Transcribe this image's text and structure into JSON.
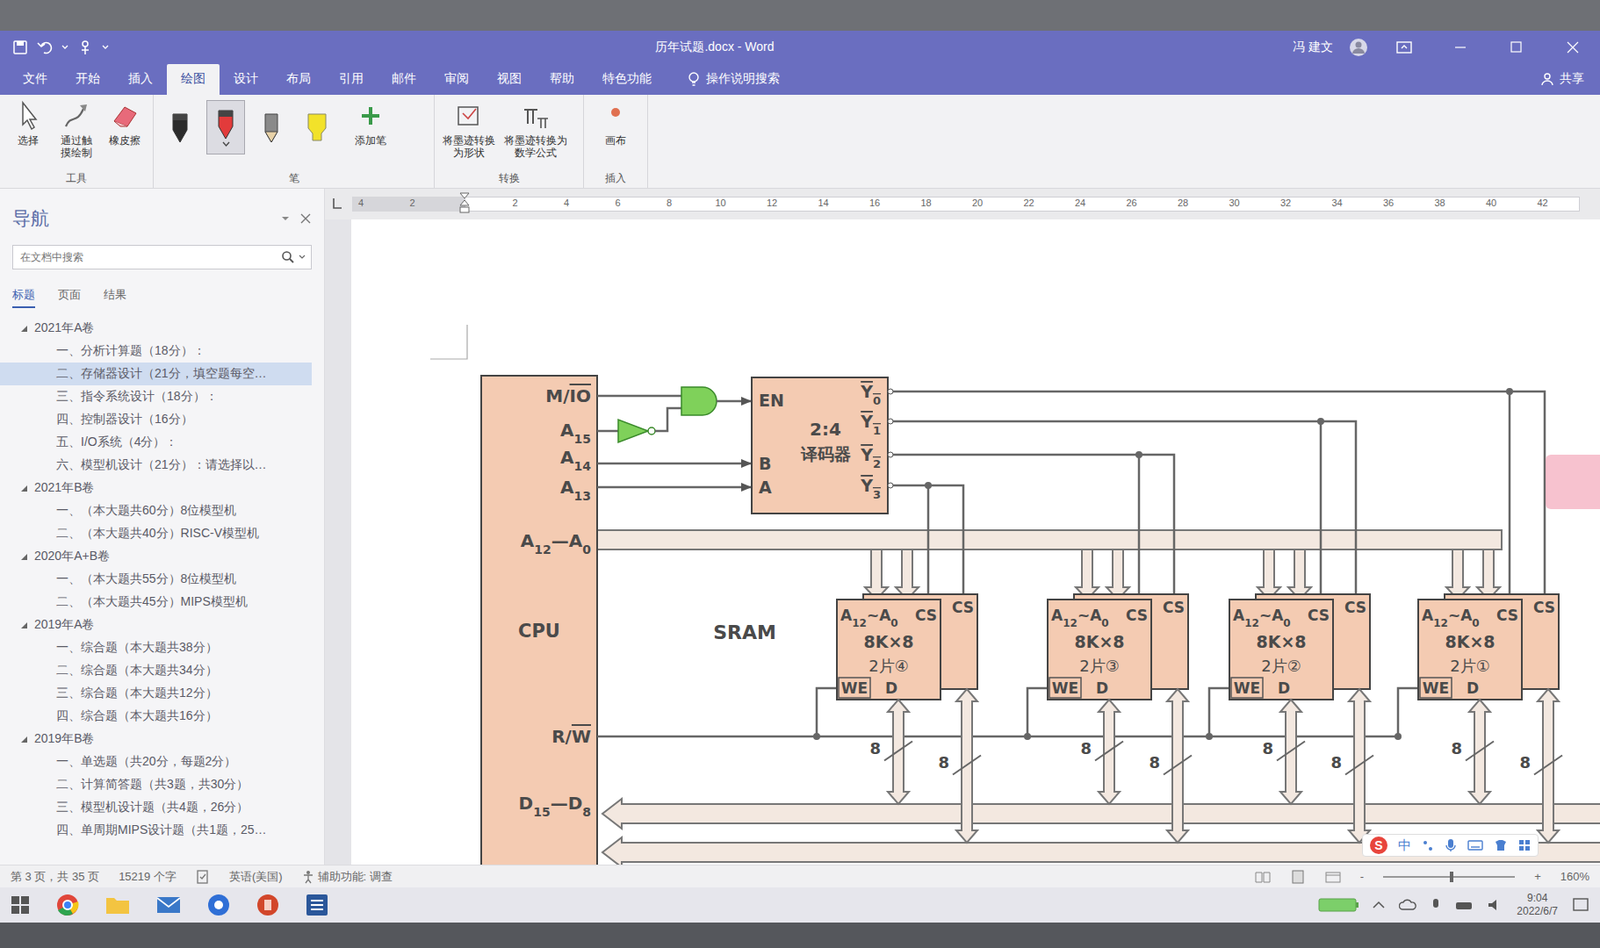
{
  "window": {
    "title": "历年试题.docx - Word",
    "user": "冯 建文"
  },
  "ribbon_tabs": [
    {
      "label": "文件",
      "selected": false
    },
    {
      "label": "开始",
      "selected": false
    },
    {
      "label": "插入",
      "selected": false
    },
    {
      "label": "绘图",
      "selected": true
    },
    {
      "label": "设计",
      "selected": false
    },
    {
      "label": "布局",
      "selected": false
    },
    {
      "label": "引用",
      "selected": false
    },
    {
      "label": "邮件",
      "selected": false
    },
    {
      "label": "审阅",
      "selected": false
    },
    {
      "label": "视图",
      "selected": false
    },
    {
      "label": "帮助",
      "selected": false
    },
    {
      "label": "特色功能",
      "selected": false
    }
  ],
  "tell_me": "操作说明搜索",
  "share": "共享",
  "ribbon": {
    "groups": [
      {
        "label": "工具",
        "items": [
          {
            "kind": "button",
            "label": "选择"
          },
          {
            "kind": "button",
            "label": "通过触摸绘制"
          },
          {
            "kind": "button",
            "label": "橡皮擦"
          }
        ]
      },
      {
        "label": "笔",
        "items": [
          {
            "kind": "pen",
            "color": "#2b2b2b",
            "selected": false
          },
          {
            "kind": "pen",
            "color": "#e23b3b",
            "selected": true
          },
          {
            "kind": "pencil",
            "color": "#8a8a8a",
            "selected": false
          },
          {
            "kind": "highlighter",
            "color": "#f2e22a",
            "selected": false
          },
          {
            "kind": "button",
            "label": "添加笔"
          }
        ]
      },
      {
        "label": "转换",
        "items": [
          {
            "kind": "button",
            "label": "将墨迹转换为形状"
          },
          {
            "kind": "button",
            "label": "将墨迹转换为数学公式"
          }
        ]
      },
      {
        "label": "插入",
        "items": [
          {
            "kind": "button",
            "label": "画布"
          }
        ]
      }
    ]
  },
  "ruler": {
    "left": [
      "4",
      "2"
    ],
    "right": [
      "2",
      "4",
      "6",
      "8",
      "10",
      "12",
      "14",
      "16",
      "18",
      "20",
      "22",
      "24",
      "26",
      "28",
      "30",
      "32",
      "34",
      "36",
      "38",
      "40",
      "42"
    ]
  },
  "nav": {
    "title": "导航",
    "search_placeholder": "在文档中搜索",
    "tabs": [
      {
        "label": "标题",
        "selected": true
      },
      {
        "label": "页面",
        "selected": false
      },
      {
        "label": "结果",
        "selected": false
      }
    ],
    "items": [
      {
        "level": 1,
        "text": "2021年A卷",
        "expanded": true,
        "selected": false
      },
      {
        "level": 2,
        "text": "一、分析计算题（18分）：",
        "selected": false
      },
      {
        "level": 2,
        "text": "二、存储器设计（21分，填空题每空…",
        "selected": true
      },
      {
        "level": 2,
        "text": "三、指令系统设计（18分）：",
        "selected": false
      },
      {
        "level": 2,
        "text": "四、控制器设计（16分）",
        "selected": false
      },
      {
        "level": 2,
        "text": "五、I/O系统（4分）：",
        "selected": false
      },
      {
        "level": 2,
        "text": "六、模型机设计（21分）：请选择以…",
        "selected": false
      },
      {
        "level": 1,
        "text": "2021年B卷",
        "expanded": true,
        "selected": false
      },
      {
        "level": 2,
        "text": "一、（本大题共60分）8位模型机",
        "selected": false
      },
      {
        "level": 2,
        "text": "二、（本大题共40分）RISC-V模型机",
        "selected": false
      },
      {
        "level": 1,
        "text": "2020年A+B卷",
        "expanded": true,
        "selected": false
      },
      {
        "level": 2,
        "text": "一、（本大题共55分）8位模型机",
        "selected": false
      },
      {
        "level": 2,
        "text": "二、（本大题共45分）MIPS模型机",
        "selected": false
      },
      {
        "level": 1,
        "text": "2019年A卷",
        "expanded": true,
        "selected": false
      },
      {
        "level": 2,
        "text": "一、综合题（本大题共38分）",
        "selected": false
      },
      {
        "level": 2,
        "text": "二、综合题（本大题共34分）",
        "selected": false
      },
      {
        "level": 2,
        "text": "三、综合题（本大题共12分）",
        "selected": false
      },
      {
        "level": 2,
        "text": "四、综合题（本大题共16分）",
        "selected": false
      },
      {
        "level": 1,
        "text": "2019年B卷",
        "expanded": true,
        "selected": false
      },
      {
        "level": 2,
        "text": "一、单选题（共20分，每题2分）",
        "selected": false
      },
      {
        "level": 2,
        "text": "二、计算简答题（共3题，共30分）",
        "selected": false
      },
      {
        "level": 2,
        "text": "三、模型机设计题（共4题，26分）",
        "selected": false
      },
      {
        "level": 2,
        "text": "四、单周期MIPS设计题（共1题，25…",
        "selected": false
      }
    ]
  },
  "diagram": {
    "cpu": {
      "label": "CPU",
      "pins": [
        {
          "parts": [
            {
              "t": "M/",
              "kind": "normal"
            },
            {
              "t": "IO",
              "kind": "over"
            }
          ]
        },
        {
          "parts": [
            {
              "t": "A",
              "kind": "normal"
            },
            {
              "t": "15",
              "kind": "sub"
            }
          ]
        },
        {
          "parts": [
            {
              "t": "A",
              "kind": "normal"
            },
            {
              "t": "14",
              "kind": "sub"
            }
          ]
        },
        {
          "parts": [
            {
              "t": "A",
              "kind": "normal"
            },
            {
              "t": "13",
              "kind": "sub"
            }
          ]
        },
        {
          "parts": [
            {
              "t": "A",
              "kind": "normal"
            },
            {
              "t": "12",
              "kind": "sub"
            },
            {
              "t": "—",
              "kind": "normal"
            },
            {
              "t": "A",
              "kind": "normal"
            },
            {
              "t": "0",
              "kind": "sub"
            }
          ]
        },
        {
          "parts": [
            {
              "t": "R/",
              "kind": "normal"
            },
            {
              "t": "W",
              "kind": "over"
            }
          ]
        },
        {
          "parts": [
            {
              "t": "D",
              "kind": "normal"
            },
            {
              "t": "15",
              "kind": "sub"
            },
            {
              "t": "—",
              "kind": "normal"
            },
            {
              "t": "D",
              "kind": "normal"
            },
            {
              "t": "8",
              "kind": "sub"
            }
          ]
        }
      ]
    },
    "decoder": {
      "title": "2:4",
      "subtitle": "译码器",
      "inputs": [
        "EN",
        "B",
        "A"
      ],
      "outputs": [
        {
          "parts": [
            {
              "t": "Y",
              "kind": "over"
            },
            {
              "t": "0",
              "kind": "oversub"
            }
          ]
        },
        {
          "parts": [
            {
              "t": "Y",
              "kind": "over"
            },
            {
              "t": "1",
              "kind": "oversub"
            }
          ]
        },
        {
          "parts": [
            {
              "t": "Y",
              "kind": "over"
            },
            {
              "t": "2",
              "kind": "oversub"
            }
          ]
        },
        {
          "parts": [
            {
              "t": "Y",
              "kind": "over"
            },
            {
              "t": "3",
              "kind": "oversub"
            }
          ]
        }
      ]
    },
    "sram_label": "SRAM",
    "chips": [
      {
        "addr": {
          "parts": [
            {
              "t": "A",
              "kind": "normal"
            },
            {
              "t": "12",
              "kind": "sub"
            },
            {
              "t": "~",
              "kind": "normal"
            },
            {
              "t": "A",
              "kind": "normal"
            },
            {
              "t": "0",
              "kind": "sub"
            }
          ]
        },
        "cs": "CS",
        "size": "8K×8",
        "count": "2片④",
        "we": "WE",
        "d": "D",
        "cs2": "CS",
        "widths": [
          "8",
          "8"
        ]
      },
      {
        "addr": {
          "parts": [
            {
              "t": "A",
              "kind": "normal"
            },
            {
              "t": "12",
              "kind": "sub"
            },
            {
              "t": "~",
              "kind": "normal"
            },
            {
              "t": "A",
              "kind": "normal"
            },
            {
              "t": "0",
              "kind": "sub"
            }
          ]
        },
        "cs": "CS",
        "size": "8K×8",
        "count": "2片③",
        "we": "WE",
        "d": "D",
        "cs2": "CS",
        "widths": [
          "8",
          "8"
        ]
      },
      {
        "addr": {
          "parts": [
            {
              "t": "A",
              "kind": "normal"
            },
            {
              "t": "12",
              "kind": "sub"
            },
            {
              "t": "~",
              "kind": "normal"
            },
            {
              "t": "A",
              "kind": "normal"
            },
            {
              "t": "0",
              "kind": "sub"
            }
          ]
        },
        "cs": "CS",
        "size": "8K×8",
        "count": "2片②",
        "we": "WE",
        "d": "D",
        "cs2": "CS",
        "widths": [
          "8",
          "8"
        ]
      },
      {
        "addr": {
          "parts": [
            {
              "t": "A",
              "kind": "normal"
            },
            {
              "t": "12",
              "kind": "sub"
            },
            {
              "t": "~",
              "kind": "normal"
            },
            {
              "t": "A",
              "kind": "normal"
            },
            {
              "t": "0",
              "kind": "sub"
            }
          ]
        },
        "cs": "CS",
        "size": "8K×8",
        "count": "2片①",
        "we": "WE",
        "d": "D",
        "cs2": "CS",
        "widths": [
          "8",
          "8"
        ]
      }
    ]
  },
  "ime": {
    "logo": "S",
    "mode": "中"
  },
  "status_bar": {
    "page": "第 3 页，共 35 页",
    "words": "15219 个字",
    "language": "英语(美国)",
    "accessibility": "辅助功能: 调查",
    "zoom_out": "-",
    "zoom_in": "+",
    "zoom_level": 0.52,
    "zoom": "160%"
  },
  "taskbar": {
    "time": "9:04",
    "date": "2022/6/7"
  }
}
